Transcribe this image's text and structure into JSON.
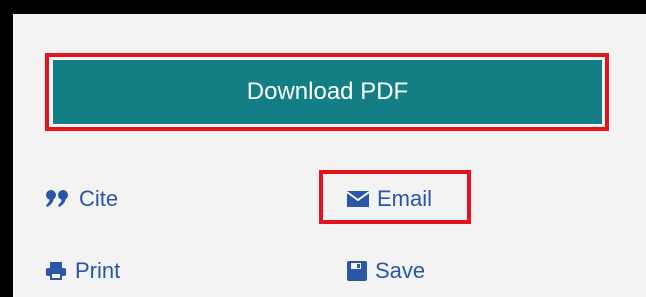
{
  "download": {
    "label": "Download PDF"
  },
  "actions": {
    "cite_label": "Cite",
    "email_label": "Email",
    "print_label": "Print",
    "save_label": "Save"
  },
  "icons": {
    "cite": "quote-icon",
    "email": "envelope-icon",
    "print": "printer-icon",
    "save": "floppy-disk-icon"
  },
  "colors": {
    "button_bg": "#137f84",
    "link_text": "#2b55a8",
    "highlight_border": "#e4141c",
    "panel_bg": "#f3f3f3",
    "frame": "#000000"
  }
}
